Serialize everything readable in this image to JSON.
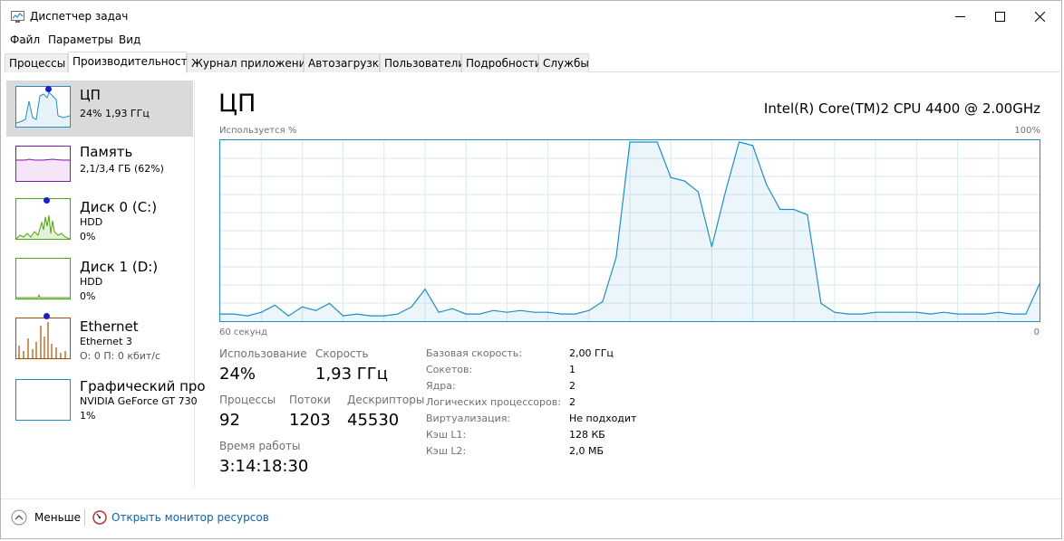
{
  "titlebar": {
    "title": "Диспетчер задач"
  },
  "menu": [
    "Файл",
    "Параметры",
    "Вид"
  ],
  "tabs": [
    "Процессы",
    "Производительность",
    "Журнал приложений",
    "Автозагрузка",
    "Пользователи",
    "Подробности",
    "Службы"
  ],
  "active_tab": "Производительность",
  "sidebar": [
    {
      "title": "ЦП",
      "lines": [
        "24%  1,93 ГГц"
      ]
    },
    {
      "title": "Память",
      "lines": [
        "2,1/3,4 ГБ (62%)"
      ]
    },
    {
      "title": "Диск 0 (C:)",
      "lines": [
        "HDD",
        "0%"
      ]
    },
    {
      "title": "Диск 1 (D:)",
      "lines": [
        "HDD",
        "0%"
      ]
    },
    {
      "title": "Ethernet",
      "lines": [
        "Ethernet 3",
        "О: 0 П: 0 кбит/с"
      ]
    },
    {
      "title": "Графический про",
      "lines": [
        "NVIDIA GeForce GT 730",
        "1%"
      ]
    }
  ],
  "main": {
    "title": "ЦП",
    "cpu_name": "Intel(R) Core(TM)2 CPU 4400 @ 2.00GHz",
    "graph_label_left": "Используется %",
    "graph_label_right": "100%",
    "axis_left": "60 секунд",
    "axis_right": "0",
    "stats": {
      "usage_label": "Использование",
      "usage_value": "24%",
      "speed_label": "Скорость",
      "speed_value": "1,93 ГГц",
      "processes_label": "Процессы",
      "processes_value": "92",
      "threads_label": "Потоки",
      "threads_value": "1203",
      "handles_label": "Дескрипторы",
      "handles_value": "45530",
      "uptime_label": "Время работы",
      "uptime_value": "3:14:18:30"
    },
    "info": [
      {
        "key": "Базовая скорость:",
        "value": "2,00 ГГц"
      },
      {
        "key": "Сокетов:",
        "value": "1"
      },
      {
        "key": "Ядра:",
        "value": "2"
      },
      {
        "key": "Логических процессоров:",
        "value": "2"
      },
      {
        "key": "Виртуализация:",
        "value": "Не подходит"
      },
      {
        "key": "Кэш L1:",
        "value": "128 КБ"
      },
      {
        "key": "Кэш L2:",
        "value": "2,0 МБ"
      }
    ]
  },
  "footer": {
    "less_label": "Меньше",
    "monitor_label": "Открыть монитор ресурсов"
  },
  "colors": {
    "accent": "#1f8ec7",
    "memory": "#8b12ae",
    "disk": "#4da60c",
    "ethernet": "#a74f01",
    "link": "#0b63a8"
  },
  "chart_data": {
    "type": "area",
    "title": "",
    "ylabel": "Используется %",
    "ylim": [
      0,
      100
    ],
    "x_range": [
      "60 секунд",
      "0"
    ],
    "values": [
      3,
      3,
      2,
      4,
      8,
      2,
      7,
      5,
      9,
      2,
      3,
      2,
      2,
      3,
      7,
      17,
      4,
      6,
      3,
      3,
      5,
      4,
      5,
      4,
      4,
      3,
      3,
      5,
      10,
      35,
      100,
      100,
      100,
      80,
      78,
      72,
      41,
      72,
      100,
      98,
      76,
      62,
      62,
      59,
      9,
      4,
      3,
      3,
      4,
      4,
      4,
      4,
      3,
      4,
      3,
      3,
      3,
      4,
      3,
      3,
      20
    ]
  }
}
